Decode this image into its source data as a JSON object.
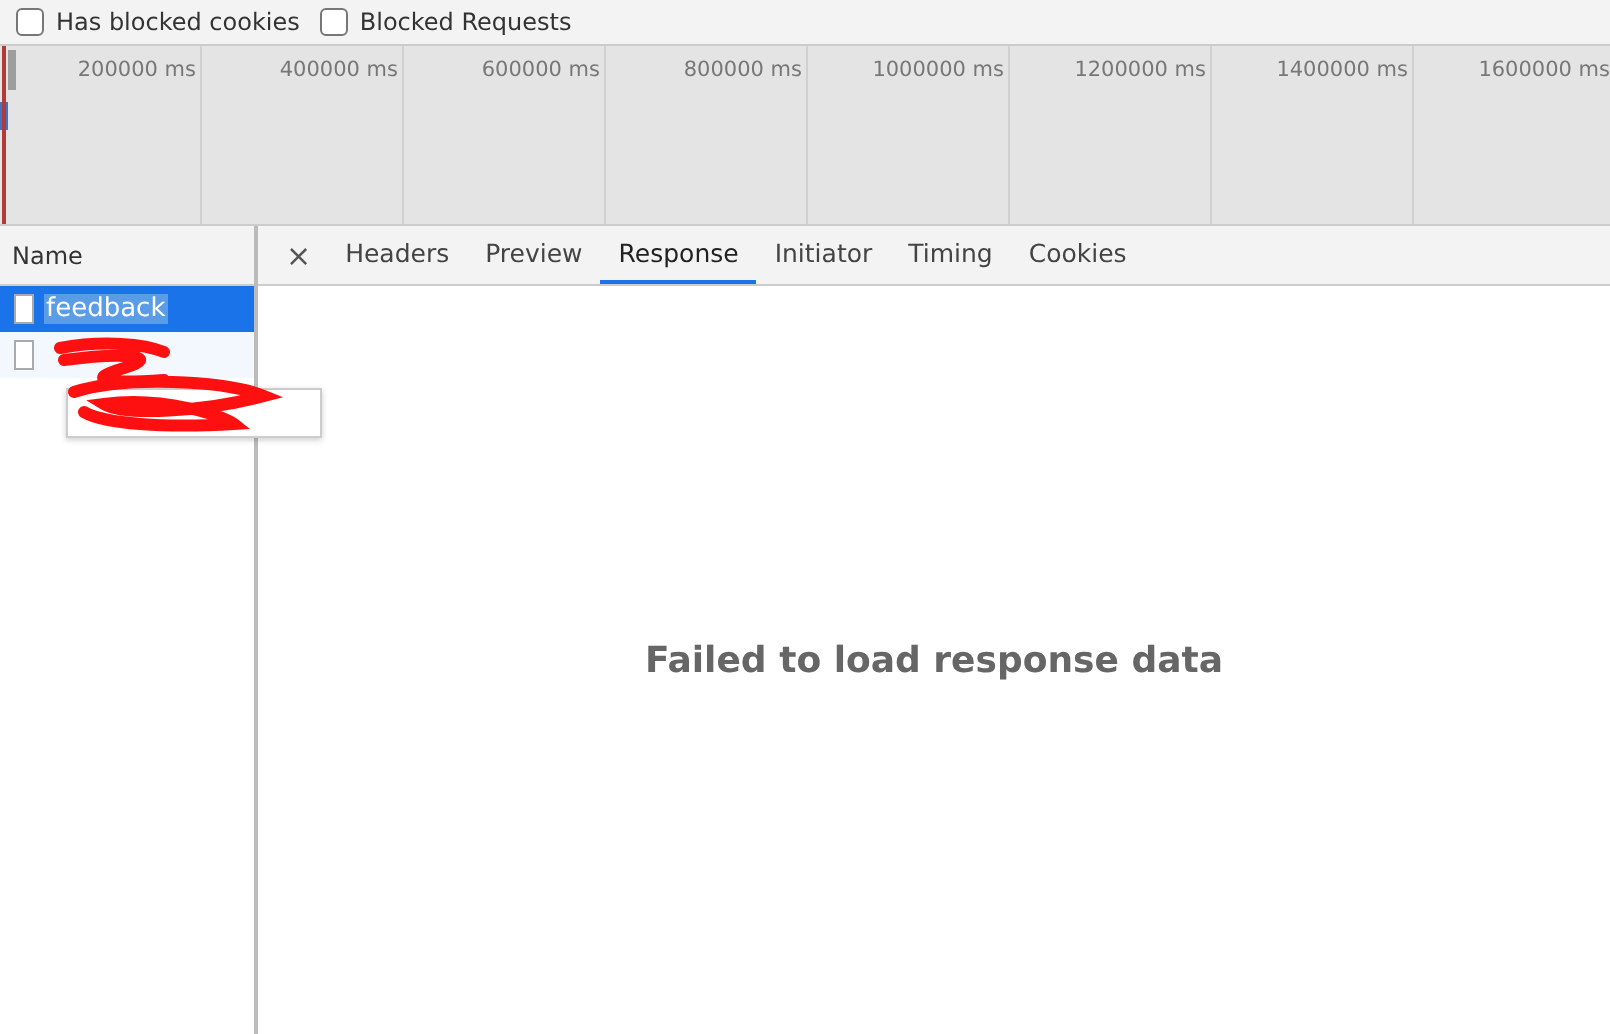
{
  "filters": [
    {
      "label": "Has blocked cookies",
      "checked": false
    },
    {
      "label": "Blocked Requests",
      "checked": false
    }
  ],
  "timeline": {
    "ticks": [
      "200000 ms",
      "400000 ms",
      "600000 ms",
      "800000 ms",
      "1000000 ms",
      "1200000 ms",
      "1400000 ms",
      "1600000 ms"
    ]
  },
  "requests": {
    "header": "Name",
    "rows": [
      {
        "name": "feedback",
        "selected": true,
        "redacted": false
      },
      {
        "selected": false,
        "redacted": true
      }
    ]
  },
  "detail": {
    "close": "×",
    "tabs": [
      {
        "label": "Headers",
        "selected": false
      },
      {
        "label": "Preview",
        "selected": false
      },
      {
        "label": "Response",
        "selected": true
      },
      {
        "label": "Initiator",
        "selected": false
      },
      {
        "label": "Timing",
        "selected": false
      },
      {
        "label": "Cookies",
        "selected": false
      }
    ],
    "message": "Failed to load response data"
  }
}
